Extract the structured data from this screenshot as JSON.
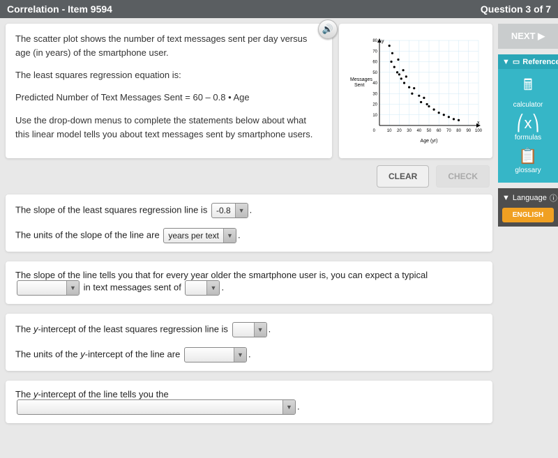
{
  "header": {
    "title": "Correlation - Item 9594",
    "progress": "Question 3 of 7"
  },
  "audio_aria": "Read aloud",
  "prompt": {
    "p1": "The scatter plot shows the number of text messages sent per day versus age (in years) of the smartphone user.",
    "p2": "The least squares regression equation is:",
    "p3": "Predicted Number of Text Messages Sent = 60 – 0.8 • Age",
    "p4": "Use the drop-down menus to complete the statements below about what this linear model tells you about text messages sent by smartphone users."
  },
  "chart": {
    "ylabel_line1": "Messages",
    "ylabel_line2": "Sent",
    "xlabel": "Age (yr)",
    "x_ticks": [
      10,
      20,
      30,
      40,
      50,
      60,
      70,
      80,
      90,
      100
    ],
    "y_ticks": [
      10,
      20,
      30,
      40,
      50,
      60,
      70,
      80
    ],
    "y_axis_var": "y",
    "x_axis_var": "x"
  },
  "buttons": {
    "clear": "CLEAR",
    "check": "CHECK",
    "next": "NEXT"
  },
  "q1": {
    "s1_pre": "The slope of the least squares regression line is",
    "s1_val": "-0.8",
    "s2_pre": "The units of the slope of the line are",
    "s2_val": "years per text"
  },
  "q2": {
    "s1_pre": "The slope of the line tells you that for every year older the smartphone user is, you can expect a typical",
    "s1_mid": "in text messages sent of"
  },
  "q3": {
    "s1_pre_a": "The ",
    "s1_pre_b": "y",
    "s1_pre_c": "-intercept of the least squares regression line is",
    "s2_pre_a": "The units of the ",
    "s2_pre_b": "y",
    "s2_pre_c": "-intercept of the line are"
  },
  "q4": {
    "pre_a": "The ",
    "pre_b": "y",
    "pre_c": "-intercept of the line tells you the"
  },
  "period": ".",
  "sidebar": {
    "reference_label": "Reference",
    "calculator": "calculator",
    "formulas": "formulas",
    "glossary": "glossary",
    "language_label": "Language",
    "language_value": "ENGLISH"
  },
  "chart_data": {
    "type": "scatter",
    "title": "",
    "xlabel": "Age (yr)",
    "ylabel": "Messages Sent",
    "xlim": [
      0,
      100
    ],
    "ylim": [
      0,
      80
    ],
    "x": [
      10,
      12,
      13,
      15,
      18,
      19,
      20,
      22,
      24,
      25,
      27,
      30,
      33,
      35,
      40,
      42,
      45,
      48,
      50,
      55,
      60,
      65,
      70,
      75,
      80
    ],
    "y": [
      75,
      60,
      68,
      55,
      50,
      62,
      48,
      44,
      52,
      40,
      46,
      36,
      30,
      35,
      28,
      22,
      26,
      20,
      18,
      15,
      12,
      10,
      8,
      6,
      5
    ]
  }
}
